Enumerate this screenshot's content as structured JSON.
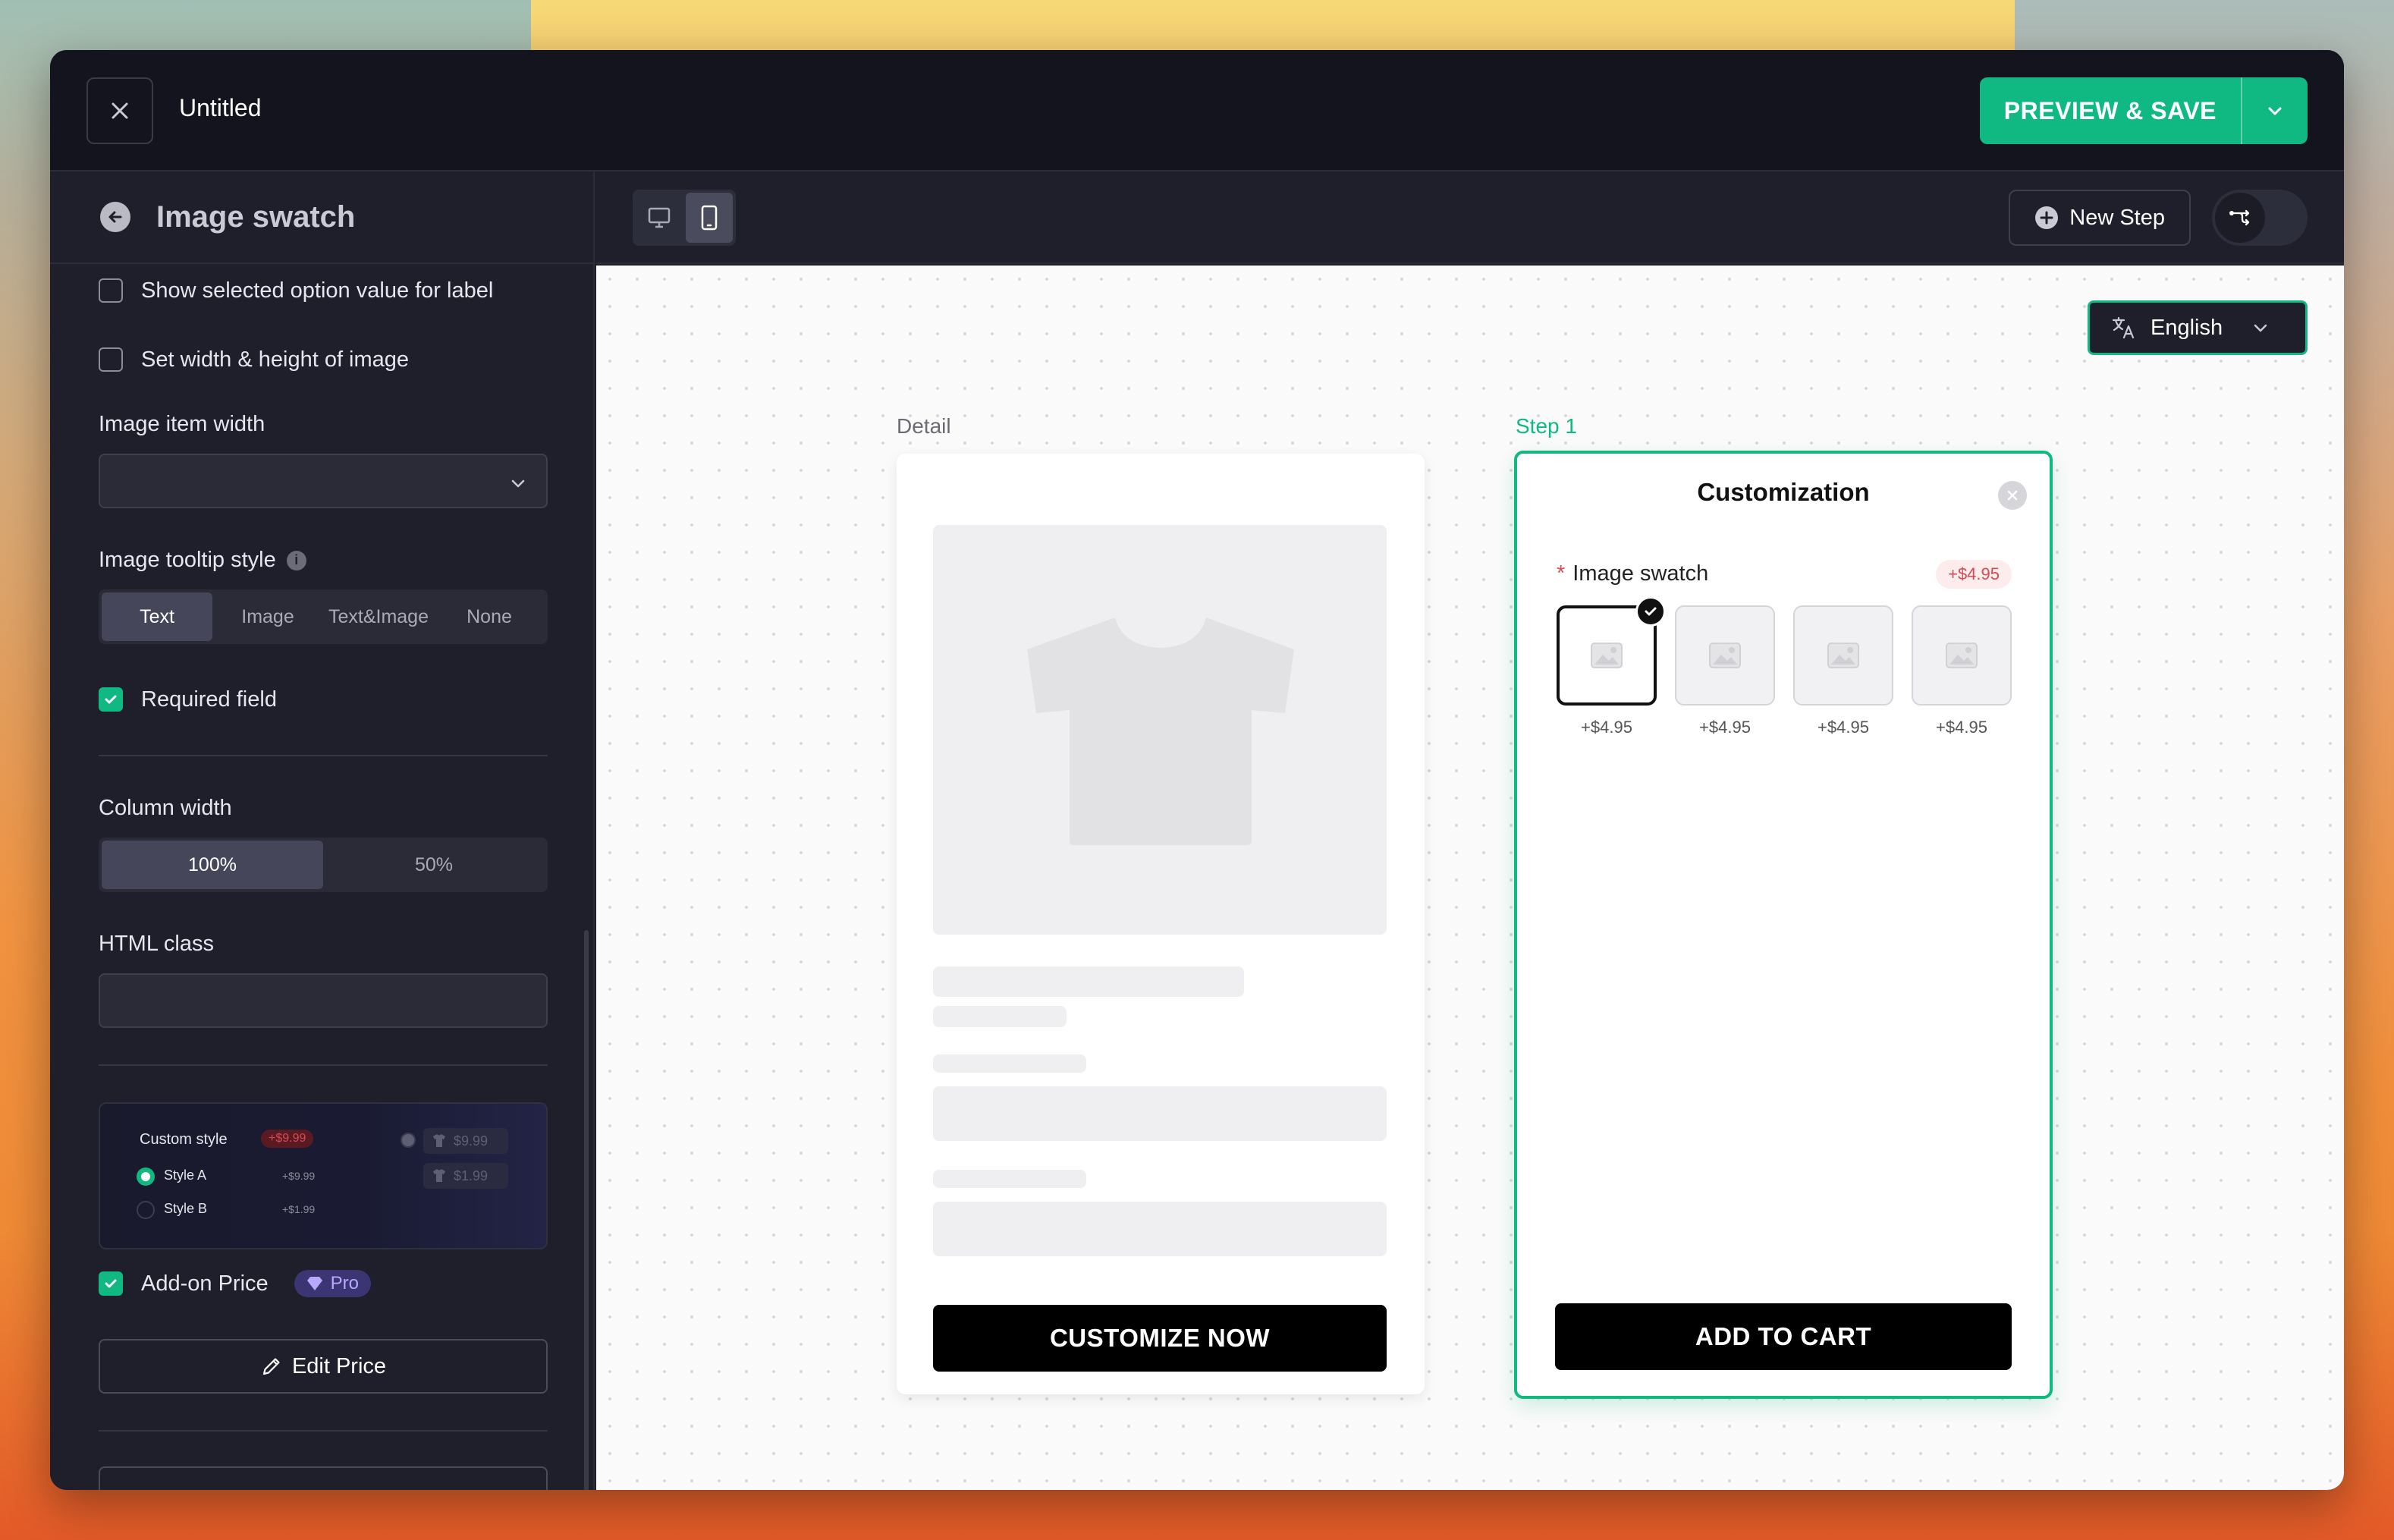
{
  "header": {
    "title": "Untitled",
    "save_label": "PREVIEW & SAVE"
  },
  "sidebar": {
    "title": "Image swatch",
    "show_selected_label": "Show selected option value for label",
    "set_width_height_label": "Set width & height of image",
    "image_item_width_label": "Image item width",
    "image_item_width_value": "",
    "tooltip_style_label": "Image tooltip style",
    "tooltip_options": [
      "Text",
      "Image",
      "Text&Image",
      "None"
    ],
    "tooltip_selected": "Text",
    "required_field_label": "Required field",
    "column_width_label": "Column width",
    "column_options": [
      "100%",
      "50%"
    ],
    "column_selected": "100%",
    "html_class_label": "HTML class",
    "html_class_value": "",
    "promo": {
      "title": "Custom style",
      "badge": "+$9.99",
      "style_a": "Style A",
      "style_a_price": "+$9.99",
      "style_b": "Style B",
      "style_b_price": "+$1.99",
      "right_price_1": "$9.99",
      "right_price_2": "$1.99"
    },
    "addon_price_label": "Add-on Price",
    "pro_label": "Pro",
    "edit_price_label": "Edit Price"
  },
  "toolbar": {
    "new_step_label": "New Step"
  },
  "canvas": {
    "language": "English",
    "detail_label": "Detail",
    "step_label": "Step 1",
    "customize_button": "CUSTOMIZE NOW",
    "customization_title": "Customization",
    "required_marker": "*",
    "field_label": "Image swatch",
    "field_price_badge": "+$4.95",
    "swatch_prices": [
      "+$4.95",
      "+$4.95",
      "+$4.95",
      "+$4.95"
    ],
    "add_to_cart": "ADD TO CART"
  },
  "colors": {
    "accent": "#10b981",
    "dark_bg": "#1e1f2a",
    "header_bg": "#13141d",
    "price_red": "#d14b56"
  }
}
